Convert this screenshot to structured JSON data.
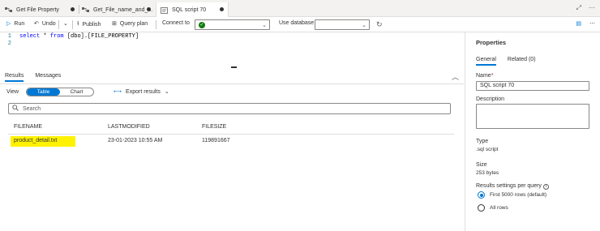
{
  "tabs": [
    {
      "label": "Get File Property",
      "icon": "pipeline-icon",
      "dirty": true
    },
    {
      "label": "Get_File_name_and_...",
      "icon": "pipeline-icon",
      "dirty": true
    },
    {
      "label": "SQL script 70",
      "icon": "sql-script-icon",
      "dirty": true,
      "active": true
    }
  ],
  "toolbar": {
    "run": "Run",
    "undo": "Undo",
    "publish": "Publish",
    "query_plan": "Query plan",
    "connect_to": "Connect to",
    "use_database": "Use database"
  },
  "editor": {
    "lines": [
      {
        "num": "1",
        "keyword1": "select",
        "plain1": " * ",
        "keyword2": "from",
        "plain2": " [dbo].[FILE_PROPERTY]"
      },
      {
        "num": "2",
        "keyword1": "",
        "plain1": "",
        "keyword2": "",
        "plain2": ""
      }
    ]
  },
  "results": {
    "tabs": [
      "Results",
      "Messages"
    ],
    "view_label": "View",
    "view_options": [
      "Table",
      "Chart"
    ],
    "export": "Export results",
    "search_placeholder": "Search",
    "columns": [
      "FILENAME",
      "LASTMODIFIED",
      "FILESIZE"
    ],
    "rows": [
      [
        "product_detail.txt",
        "23-01-2023 10:55 AM",
        "119891667"
      ]
    ]
  },
  "properties": {
    "title": "Properties",
    "tabs": [
      "General",
      "Related (0)"
    ],
    "name_label": "Name",
    "name_value": "SQL script 70",
    "description_label": "Description",
    "type_label": "Type",
    "type_value": ".sql script",
    "size_label": "Size",
    "size_value": "253 bytes",
    "results_settings_label": "Results settings per query",
    "radio_options": [
      "First 5000 rows (default)",
      "All rows"
    ],
    "selected_option": 0
  },
  "colors": {
    "accent": "#0078d4",
    "highlight": "#fff200",
    "connected": "#107c10"
  }
}
